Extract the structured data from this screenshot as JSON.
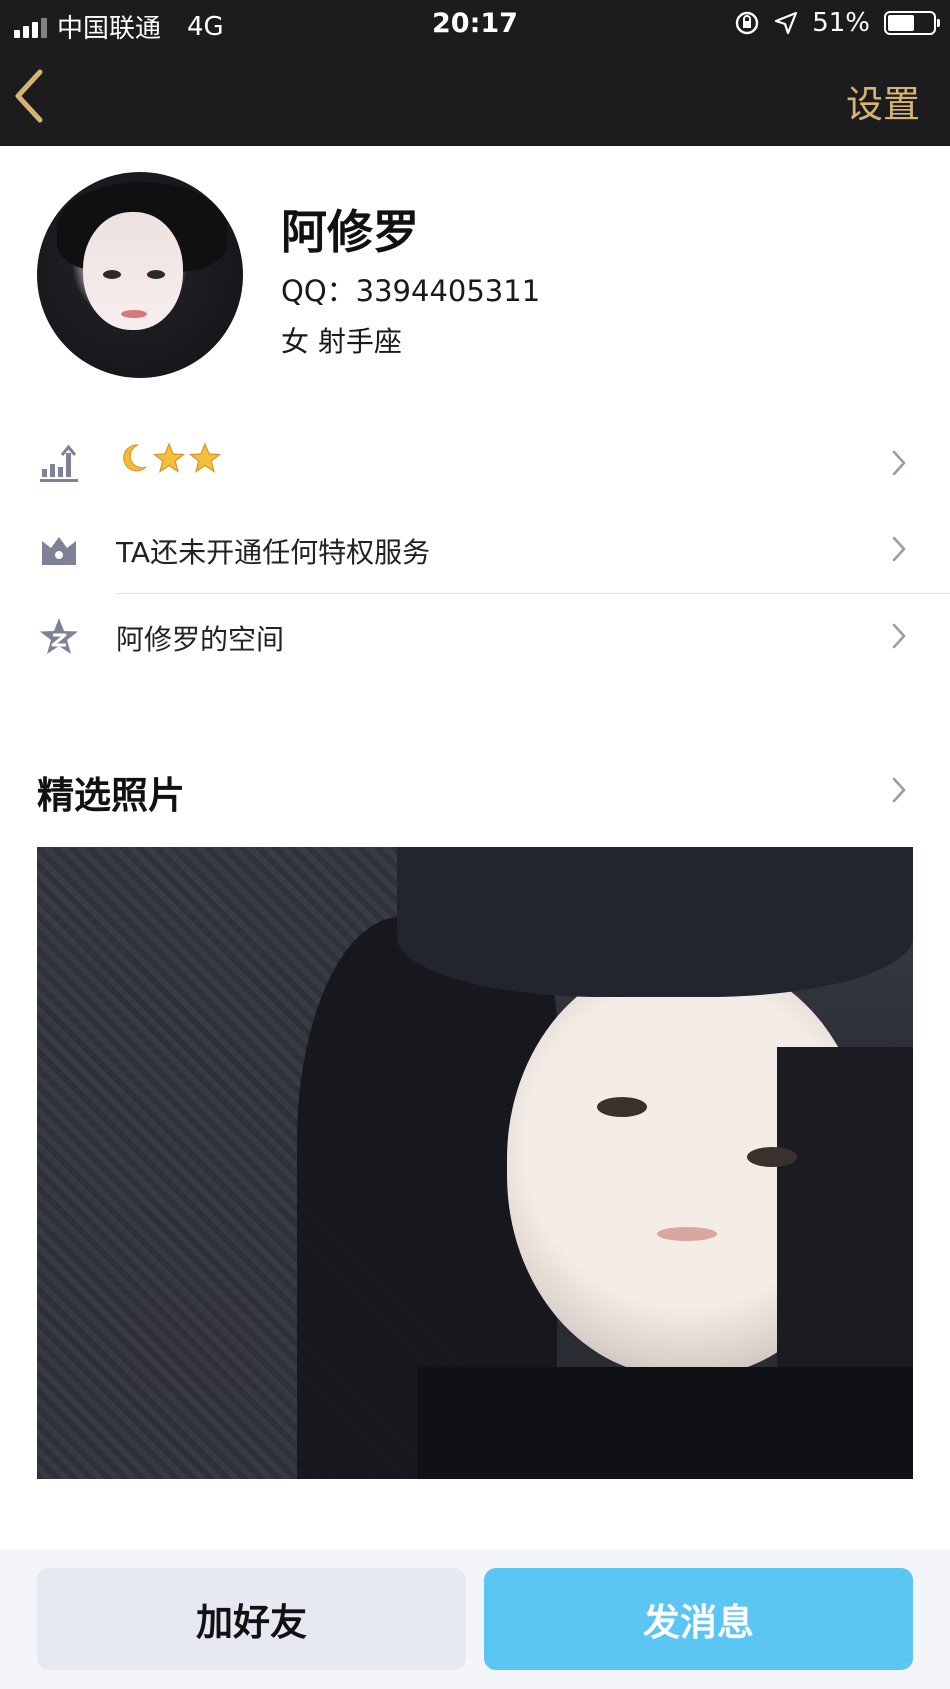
{
  "status_bar": {
    "carrier": "中国联通",
    "network": "4G",
    "time": "20:17",
    "battery": "51%"
  },
  "nav": {
    "back_icon": "chevron-left-icon",
    "settings_label": "设置"
  },
  "profile": {
    "name": "阿修罗",
    "qq": "QQ：3394405311",
    "gender_zodiac": "女  射手座"
  },
  "rows": [
    {
      "icon": "level-chart-icon",
      "level_icons": [
        "moon-icon",
        "star-icon",
        "star-icon"
      ]
    },
    {
      "icon": "crown-icon",
      "label": "TA还未开通任何特权服务"
    },
    {
      "icon": "qzone-star-icon",
      "label": "阿修罗的空间"
    }
  ],
  "photos": {
    "title": "精选照片"
  },
  "actions": {
    "add_friend": "加好友",
    "send_message": "发消息"
  },
  "colors": {
    "header_bg": "#1c1c1e",
    "accent_gold": "#d6b472",
    "primary_blue": "#5bc5f3",
    "secondary_btn": "#e6e9f1"
  }
}
